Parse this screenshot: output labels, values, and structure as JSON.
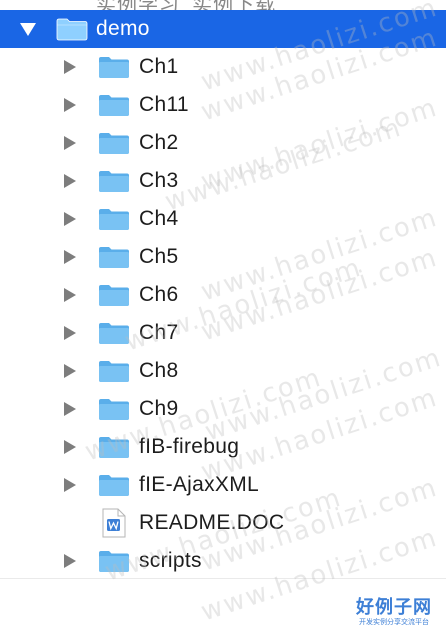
{
  "top_partial": "实例学习_实例下载",
  "root": {
    "label": "demo",
    "expanded": true,
    "selected": true
  },
  "items": [
    {
      "label": "Ch1",
      "type": "folder"
    },
    {
      "label": "Ch11",
      "type": "folder"
    },
    {
      "label": "Ch2",
      "type": "folder"
    },
    {
      "label": "Ch3",
      "type": "folder"
    },
    {
      "label": "Ch4",
      "type": "folder"
    },
    {
      "label": "Ch5",
      "type": "folder"
    },
    {
      "label": "Ch6",
      "type": "folder"
    },
    {
      "label": "Ch7",
      "type": "folder"
    },
    {
      "label": "Ch8",
      "type": "folder"
    },
    {
      "label": "Ch9",
      "type": "folder"
    },
    {
      "label": "fIB-firebug",
      "type": "folder"
    },
    {
      "label": "fIE-AjaxXML",
      "type": "folder"
    },
    {
      "label": "README.DOC",
      "type": "file"
    },
    {
      "label": "scripts",
      "type": "folder"
    }
  ],
  "watermark": {
    "text": "www.haolizi.com"
  },
  "logo": {
    "title": "好例子网",
    "subtitle": "开发实例分享交流平台"
  },
  "colors": {
    "selection": "#1a66e5",
    "folder": "#6cb8f0",
    "disclosure": "#7d7d7d",
    "text": "#1d1d1d",
    "doc_icon": "#3d7fd6"
  }
}
